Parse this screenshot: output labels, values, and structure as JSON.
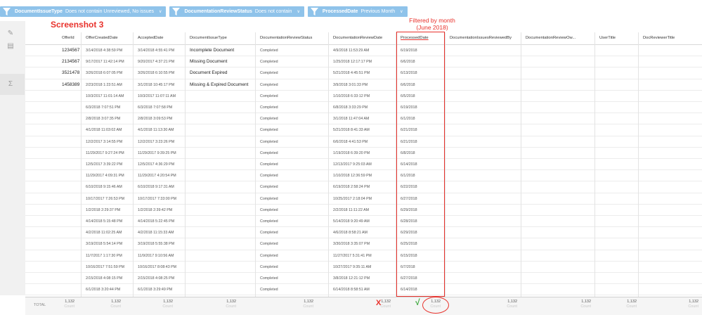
{
  "filters": [
    {
      "field": "DocumentIssueType",
      "condition": "Does not contain Unreviewed, No issues"
    },
    {
      "field": "DocumentationReviewStatus",
      "condition": "Does not contain"
    },
    {
      "field": "ProcessedDate",
      "condition": "Previous Month"
    }
  ],
  "annotations": {
    "title": "Screenshot 3",
    "filter_note_line1": "Filtered by month",
    "filter_note_line2": "(June 2018)",
    "x_mark": "X",
    "check_mark": "√"
  },
  "columns": [
    "OfferId",
    "OfferCreatedDate",
    "AcceptedDate",
    "DocumentIssueType",
    "DocumentationReviewStatus",
    "DocumentationReviewDate",
    "ProcessedDate",
    "DocumentationIssuesReviewedBy",
    "DocumentationReviewOw...",
    "UserTitle",
    "DocReviewerTitle"
  ],
  "rows": [
    [
      "1234567",
      "3/14/2018 4:38:59 PM",
      "3/14/2018 4:55:41 PM",
      "Incomplete Document",
      "Completed",
      "4/9/2018 11:53:29 AM",
      "6/19/2018"
    ],
    [
      "2134567",
      "9/17/2017 11:42:14 PM",
      "9/20/2017 4:37:21 PM",
      "Missing Document",
      "Completed",
      "1/25/2018 12:17:17 PM",
      "6/6/2018"
    ],
    [
      "3521478",
      "3/26/2018 6:07:05 PM",
      "3/26/2018 6:10:55 PM",
      "Document Expired",
      "Completed",
      "5/21/2018 4:45:51 PM",
      "6/13/2018"
    ],
    [
      "1458389",
      "2/23/2018 1:23:51 AM",
      "3/1/2018 10:45:17 PM",
      "Missing & Expired Document",
      "Completed",
      "3/9/2018 3:01:33 PM",
      "6/6/2018"
    ],
    [
      "",
      "10/3/2017 11:01:14 AM",
      "10/3/2017 11:07:11 AM",
      "",
      "Completed",
      "1/10/2018 6:33:12 PM",
      "6/5/2018"
    ],
    [
      "",
      "6/3/2018 7:07:51 PM",
      "6/3/2018 7:07:58 PM",
      "",
      "Completed",
      "6/8/2018 3:33:29 PM",
      "6/19/2018"
    ],
    [
      "",
      "2/8/2018 3:07:35 PM",
      "2/8/2018 3:09:53 PM",
      "",
      "Completed",
      "3/1/2018 11:47:04 AM",
      "6/1/2018"
    ],
    [
      "",
      "4/1/2018 11:03:02 AM",
      "4/1/2018 11:13:30 AM",
      "",
      "Completed",
      "5/21/2018 8:41:33 AM",
      "6/21/2018"
    ],
    [
      "",
      "12/2/2017 3:14:55 PM",
      "12/2/2017 3:23:26 PM",
      "",
      "Completed",
      "6/6/2018 4:41:53 PM",
      "6/21/2018"
    ],
    [
      "",
      "11/29/2017 9:27:24 PM",
      "11/29/2017 9:39:25 PM",
      "",
      "Completed",
      "1/19/2018 6:39:20 PM",
      "6/8/2018"
    ],
    [
      "",
      "12/5/2017 3:39:22 PM",
      "12/5/2017 4:36:29 PM",
      "",
      "Completed",
      "12/13/2017 9:25:03 AM",
      "6/14/2018"
    ],
    [
      "",
      "11/29/2017 4:09:31 PM",
      "11/29/2017 4:20:54 PM",
      "",
      "Completed",
      "1/10/2018 12:36:59 PM",
      "6/1/2018"
    ],
    [
      "",
      "6/10/2018 9:15:46 AM",
      "6/10/2018 9:17:31 AM",
      "",
      "Completed",
      "6/19/2018 2:58:24 PM",
      "6/22/2018"
    ],
    [
      "",
      "10/17/2017 7:26:53 PM",
      "10/17/2017 7:33:00 PM",
      "",
      "Completed",
      "10/25/2017 2:18:04 PM",
      "6/27/2018"
    ],
    [
      "",
      "1/2/2018 2:29:37 PM",
      "1/2/2018 2:39:42 PM",
      "",
      "Completed",
      "2/2/2018 11:11:22 AM",
      "6/29/2018"
    ],
    [
      "",
      "4/14/2018 5:15:48 PM",
      "4/14/2018 5:22:45 PM",
      "",
      "Completed",
      "5/14/2018 9:20:49 AM",
      "6/28/2018"
    ],
    [
      "",
      "4/2/2018 11:02:25 AM",
      "4/2/2018 11:15:33 AM",
      "",
      "Completed",
      "4/6/2018 8:58:21 AM",
      "6/29/2018"
    ],
    [
      "",
      "3/19/2018 5:54:14 PM",
      "3/19/2018 5:55:38 PM",
      "",
      "Completed",
      "3/30/2018 3:35:07 PM",
      "6/25/2018"
    ],
    [
      "",
      "11/7/2017 1:17:30 PM",
      "11/9/2017 9:10:56 AM",
      "",
      "Completed",
      "11/27/2017 5:31:41 PM",
      "6/15/2018"
    ],
    [
      "",
      "10/16/2017 7:51:59 PM",
      "10/16/2017 8:08:43 PM",
      "",
      "Completed",
      "10/27/2017 9:35:11 AM",
      "6/7/2018"
    ],
    [
      "",
      "2/15/2018 4:08:15 PM",
      "2/15/2018 4:08:25 PM",
      "",
      "Completed",
      "3/8/2018 12:21:12 PM",
      "6/27/2018"
    ],
    [
      "",
      "6/1/2018 3:20:44 PM",
      "6/1/2018 3:29:49 PM",
      "",
      "Completed",
      "6/14/2018 8:58:51 AM",
      "6/14/2018"
    ]
  ],
  "totals": {
    "label": "TOTAL",
    "value": "1,132",
    "sub": "Count"
  },
  "colors": {
    "filter_pill": "#8fc3ea",
    "annotation_red": "#e8322c",
    "check_green": "#3aa83a"
  },
  "sidebar_icons": [
    "pencil-icon",
    "clipboard-icon",
    "sigma-icon"
  ]
}
